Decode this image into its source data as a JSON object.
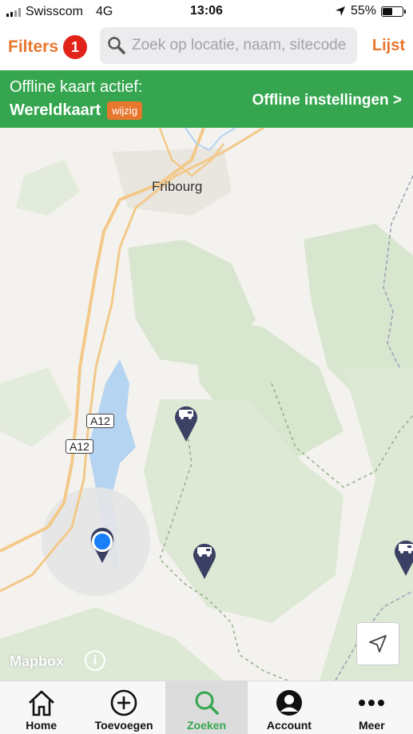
{
  "status_bar": {
    "carrier": "Swisscom",
    "network": "4G",
    "time": "13:06",
    "battery": "55%",
    "battery_level": 0.55
  },
  "header": {
    "filters_label": "Filters",
    "filters_count": "1",
    "search_placeholder": "Zoek op locatie, naam, sitecode",
    "list_label": "Lijst"
  },
  "offline_banner": {
    "line1": "Offline kaart actief:",
    "map_name": "Wereldkaart",
    "change_label": "wijzig",
    "settings_label": "Offline instellingen >"
  },
  "map": {
    "city_label": "Fribourg",
    "road_label_1": "A12",
    "road_label_2": "A12",
    "attribution": "Mapbox",
    "info_icon": "i",
    "pins": [
      "camper-pin",
      "camper-pin",
      "camper-pin",
      "camper-pin"
    ]
  },
  "tabs": [
    {
      "label": "Home",
      "icon": "home-icon"
    },
    {
      "label": "Toevoegen",
      "icon": "add-icon"
    },
    {
      "label": "Zoeken",
      "icon": "search-icon",
      "active": true
    },
    {
      "label": "Account",
      "icon": "account-icon"
    },
    {
      "label": "Meer",
      "icon": "more-icon"
    }
  ],
  "colors": {
    "accent": "#e8772e",
    "banner": "#35a64f",
    "badge": "#e2231a",
    "pin": "#3b4164",
    "location": "#1a7ef7"
  }
}
